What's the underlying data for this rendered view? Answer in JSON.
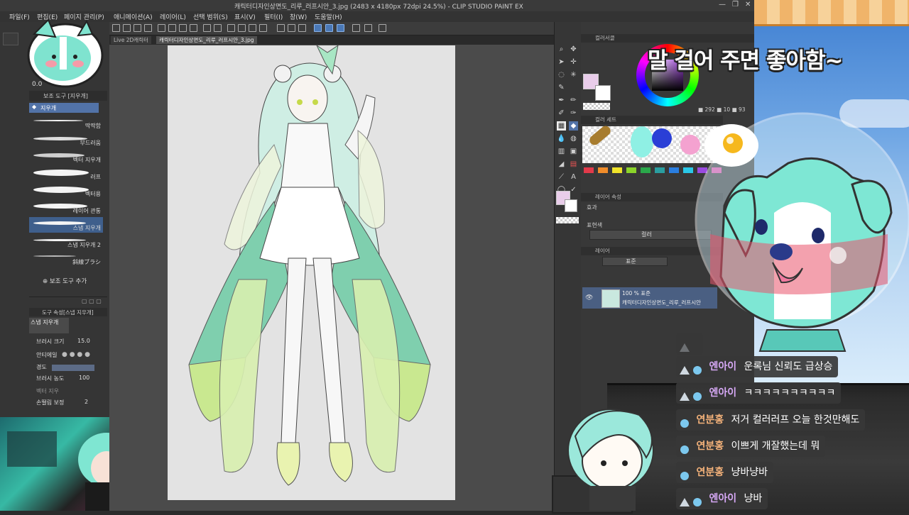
{
  "window": {
    "title": "캐릭터디자인상면도_리루_러프시안_3.jpg (2483 x 4180px 72dpi 24.5%) - CLIP STUDIO PAINT EX",
    "controls": [
      "—",
      "❐",
      "✕"
    ]
  },
  "menu": [
    {
      "label": "파일(F)"
    },
    {
      "label": "편집(E)"
    },
    {
      "label": "페이지 관리(P)"
    },
    {
      "label": "애니메이션(A)"
    },
    {
      "label": "레이어(L)"
    },
    {
      "label": "선택 범위(S)"
    },
    {
      "label": "표시(V)"
    },
    {
      "label": "필터(I)"
    },
    {
      "label": "창(W)"
    },
    {
      "label": "도움말(H)"
    }
  ],
  "document_tabs": [
    {
      "label": "Live 2D캐릭터",
      "active": false
    },
    {
      "label": "캐릭터디자인상면도_리루_러프시안_3.jpg",
      "active": true
    }
  ],
  "navigator": {
    "zoom": "0.0"
  },
  "subtool_panel": {
    "title": "보조 도구 [지우개]",
    "group": "지우개",
    "brushes": [
      {
        "label": "딱딱함",
        "selected": false
      },
      {
        "label": "부드러움",
        "selected": false
      },
      {
        "label": "벡터 지우개",
        "selected": false
      },
      {
        "label": "러프",
        "selected": false
      },
      {
        "label": "벡터용",
        "selected": false
      },
      {
        "label": "레이어 관통",
        "selected": false
      },
      {
        "label": "스냅 지우개",
        "selected": true
      },
      {
        "label": "스냅 지우개 2",
        "selected": false
      },
      {
        "label": "斜線ブラシ",
        "selected": false
      }
    ],
    "add_label": "보조 도구 추가"
  },
  "tool_property": {
    "title": "도구 속성[스냅 지우개]",
    "preview_label": "스냅 지우개",
    "rows": [
      {
        "label": "브러시 크기",
        "value": "15.0"
      },
      {
        "label": "안티에일",
        "value": ""
      },
      {
        "label": "경도",
        "value": ""
      },
      {
        "label": "브러시 농도",
        "value": "100"
      },
      {
        "label": "벡터 지우",
        "value": ""
      },
      {
        "label": "손떨림 보정",
        "value": "2"
      }
    ]
  },
  "color_panel": {
    "title": "컬러서클",
    "readout": "■ 292 ■ 10 ■ 93",
    "main_color": "#e9cdea",
    "sub_color": "#ffffff"
  },
  "color_set": {
    "title": "컬러 세트",
    "swatch_colors": [
      "#e23a4a",
      "#f08c2a",
      "#f0e32a",
      "#8bd42a",
      "#2aa84a",
      "#2a9ea0",
      "#2a7ee0",
      "#2ac8e8",
      "#9a4ae0",
      "#e04aa8"
    ]
  },
  "layer_property": {
    "title": "레이어 속성",
    "effect_label": "효과",
    "expression_label": "표현색",
    "expression_value": "컬러"
  },
  "layer_panel": {
    "title": "레이어",
    "blend_mode": "표준",
    "layers": [
      {
        "percent": "100 % 표준",
        "name": "캐릭터디자인상면도_리루_러프시안"
      }
    ]
  },
  "overlay": {
    "banner": "말 걸어 주면 좋아함~"
  },
  "chat": [
    {
      "nick": "",
      "message": "",
      "nick_color": "#d6a8f5",
      "faded": true
    },
    {
      "nick": "엔아이",
      "message": "운록님 신뢰도 급상승",
      "nick_color": "#d6a8f5"
    },
    {
      "nick": "엔아이",
      "message": "ㅋㅋㅋㅋㅋㅋㅋㅋㅋㅋ",
      "nick_color": "#d6a8f5"
    },
    {
      "nick": "연분홍",
      "message": "저거 컬러러프 오늘 한것만해도",
      "nick_color": "#f4b27a"
    },
    {
      "nick": "연분홍",
      "message": "이쁘게 개잘했는데 뭐",
      "nick_color": "#f4b27a"
    },
    {
      "nick": "연분홍",
      "message": "냥바냥바",
      "nick_color": "#f4b27a"
    },
    {
      "nick": "엔아이",
      "message": "냥바",
      "nick_color": "#d6a8f5"
    }
  ]
}
